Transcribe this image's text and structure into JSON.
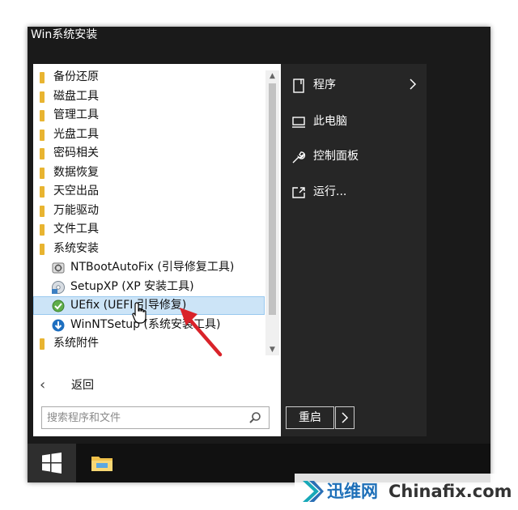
{
  "window": {
    "title": "Win系统安装"
  },
  "tree": {
    "folders_top": [
      {
        "label": "备份还原"
      },
      {
        "label": "磁盘工具"
      },
      {
        "label": "管理工具"
      },
      {
        "label": "光盘工具"
      },
      {
        "label": "密码相关"
      },
      {
        "label": "数据恢复"
      },
      {
        "label": "天空出品"
      },
      {
        "label": "万能驱动"
      },
      {
        "label": "文件工具"
      },
      {
        "label": "系统安装"
      }
    ],
    "children": [
      {
        "label": "NTBootAutoFix (引导修复工具)",
        "icon": "ntbootautofix-icon"
      },
      {
        "label": "SetupXP (XP 安装工具)",
        "icon": "setupxp-icon"
      },
      {
        "label": "UEfix (UEFI 引导修复)",
        "icon": "uefix-icon",
        "selected": true
      },
      {
        "label": "WinNTSetup (系统安装工具)",
        "icon": "winntsetup-icon"
      }
    ],
    "folders_bottom": [
      {
        "label": "系统附件"
      }
    ],
    "folder_color": "#e8b431",
    "selection_color": "#cce4f7"
  },
  "back": {
    "label": "返回"
  },
  "search": {
    "placeholder": "搜索程序和文件",
    "value": ""
  },
  "right_menu": {
    "items": [
      {
        "label": "程序",
        "icon": "programs-icon",
        "has_submenu": true
      },
      {
        "label": "此电脑",
        "icon": "computer-icon"
      },
      {
        "label": "控制面板",
        "icon": "wrench-icon"
      },
      {
        "label": "运行...",
        "icon": "run-icon"
      }
    ]
  },
  "power": {
    "restart_label": "重启"
  },
  "taskbar": {
    "start_icon": "windows-logo-icon",
    "pinned": [
      "file-explorer-icon"
    ]
  },
  "watermark": {
    "cn": "迅维网",
    "en": "Chinafix.com"
  },
  "colors": {
    "dark_panel": "#262626",
    "frame": "#1a1a1a",
    "taskbar": "#111111",
    "accent_arrow": "#d9232a"
  }
}
